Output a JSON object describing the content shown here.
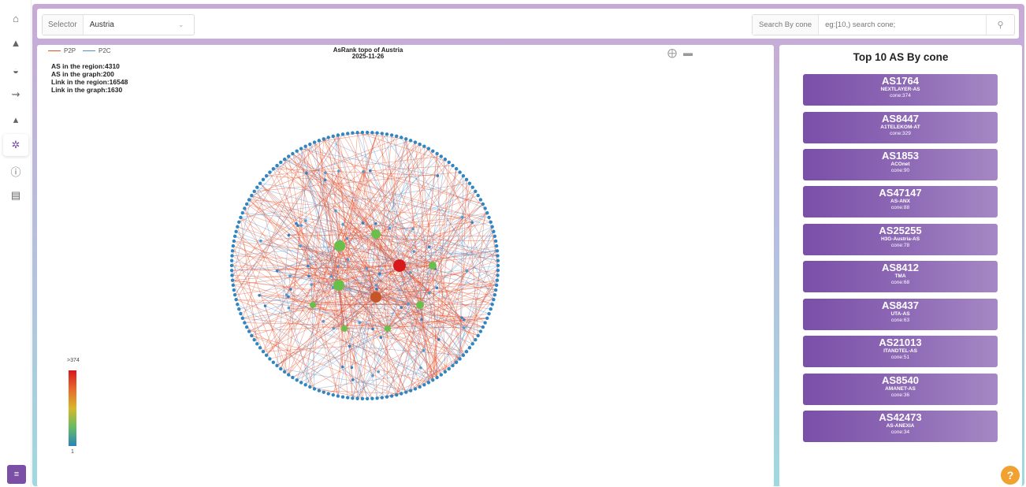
{
  "sidebar": {
    "items": [
      {
        "icon": "home-icon",
        "glyph": "⌂"
      },
      {
        "icon": "warning-icon",
        "glyph": "▲"
      },
      {
        "icon": "dashboard-icon",
        "glyph": "◒"
      },
      {
        "icon": "route-icon",
        "glyph": "⇝"
      },
      {
        "icon": "bell-icon",
        "glyph": "▴"
      },
      {
        "icon": "network-topology-icon",
        "glyph": "✲"
      },
      {
        "icon": "info-icon",
        "glyph": "ⓘ"
      },
      {
        "icon": "document-icon",
        "glyph": "▤"
      }
    ],
    "menu_glyph": "≡"
  },
  "topbar": {
    "selector_label": "Selector",
    "selector_value": "Austria",
    "search_label": "Search By cone",
    "search_placeholder": "eg:[10,) search cone;",
    "search_value": ""
  },
  "graph": {
    "legend_p2p": "P2P",
    "legend_p2c": "P2C",
    "p2p_color": "#e8502c",
    "p2c_color": "#4f8fd0",
    "title": "AsRank topo of Austria",
    "date": "2025-11-26",
    "stats": [
      "AS in the region:4310",
      "AS in the graph:200",
      "Link in the region:16548",
      "Link in the graph:1630"
    ],
    "colorbar_max": ">374",
    "colorbar_min": "1"
  },
  "right_panel": {
    "title": "Top 10 AS By cone",
    "items": [
      {
        "asn": "AS1764",
        "name": "NEXTLAYER-AS",
        "cone": "cone:374"
      },
      {
        "asn": "AS8447",
        "name": "A1TELEKOM-AT",
        "cone": "cone:329"
      },
      {
        "asn": "AS1853",
        "name": "ACOnet",
        "cone": "cone:90"
      },
      {
        "asn": "AS47147",
        "name": "AS-ANX",
        "cone": "cone:88"
      },
      {
        "asn": "AS25255",
        "name": "H3G-Austria-AS",
        "cone": "cone:78"
      },
      {
        "asn": "AS8412",
        "name": "TMA",
        "cone": "cone:68"
      },
      {
        "asn": "AS8437",
        "name": "UTA-AS",
        "cone": "cone:63"
      },
      {
        "asn": "AS21013",
        "name": "ITANDTEL-AS",
        "cone": "cone:51"
      },
      {
        "asn": "AS8540",
        "name": "AMANET-AS",
        "cone": "cone:36"
      },
      {
        "asn": "AS42473",
        "name": "AS-ANEXIA",
        "cone": "cone:34"
      }
    ]
  },
  "help_glyph": "?"
}
